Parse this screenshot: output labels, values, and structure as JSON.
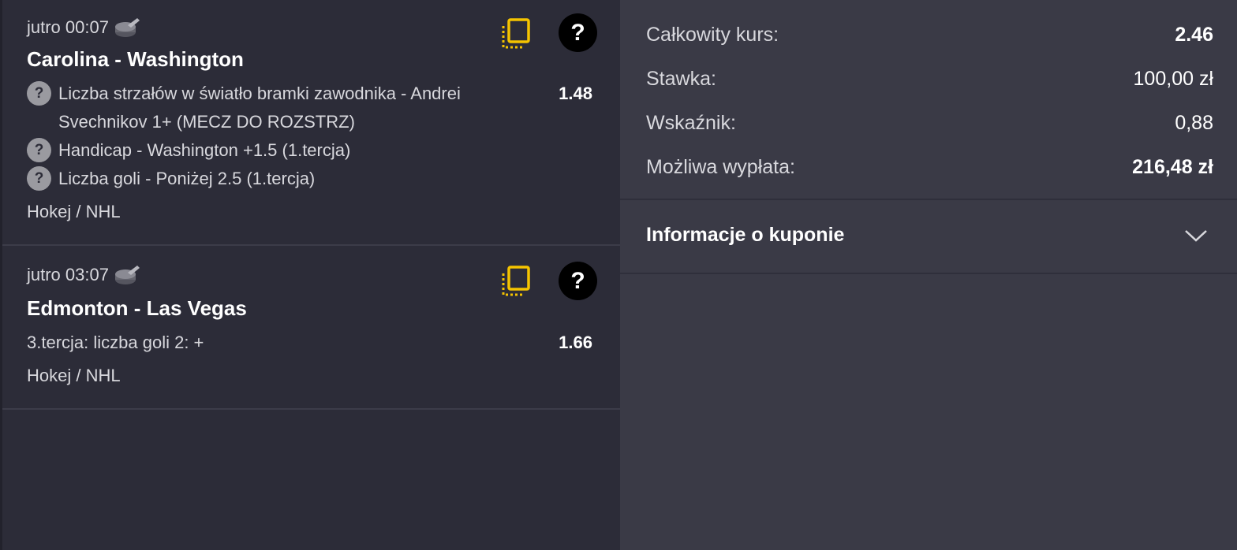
{
  "events": [
    {
      "time": "jutro 00:07",
      "sport_icon": "hockey-puck-icon",
      "title": "Carolina - Washington",
      "selections": [
        {
          "text": "Liczba strzałów w światło bramki zawodnika - Andrei Svechnikov 1+ (MECZ DO ROZSTRZ)",
          "odds": "1.48",
          "icon": "question-icon"
        },
        {
          "text": "Handicap - Washington +1.5 (1.tercja)",
          "odds": "",
          "icon": "question-icon"
        },
        {
          "text": "Liczba goli - Poniżej 2.5 (1.tercja)",
          "odds": "",
          "icon": "question-icon"
        }
      ],
      "category": "Hokej / NHL"
    },
    {
      "time": "jutro 03:07",
      "sport_icon": "hockey-puck-icon",
      "title": "Edmonton - Las Vegas",
      "selections": [
        {
          "text": "3.tercja: liczba goli 2: +",
          "odds": "1.66",
          "icon": ""
        }
      ],
      "category": "Hokej / NHL"
    }
  ],
  "help_glyph": "?",
  "summary": {
    "total_odds_label": "Całkowity kurs:",
    "total_odds_value": "2.46",
    "stake_label": "Stawka:",
    "stake_value": "100,00 zł",
    "ratio_label": "Wskaźnik:",
    "ratio_value": "0,88",
    "payout_label": "Możliwa wypłata:",
    "payout_value": "216,48 zł"
  },
  "coupon_info": {
    "label": "Informacje o kuponie"
  },
  "colors": {
    "accent_yellow": "#f5c400",
    "left_bg": "#2c2c38",
    "right_bg": "#3a3a46"
  }
}
